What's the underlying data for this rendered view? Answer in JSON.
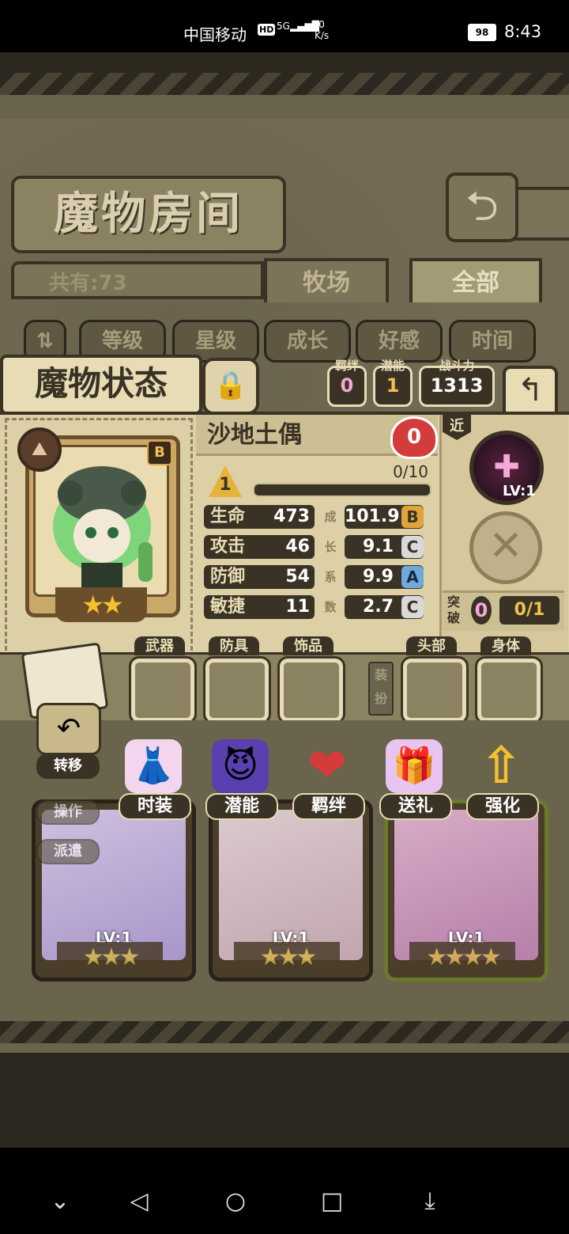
{
  "status_bar": {
    "carrier": "中国移动",
    "hd": "HD",
    "signal": "5G",
    "speed_value": "0",
    "speed_unit": "K/s",
    "battery": "98",
    "time": "8:43"
  },
  "header": {
    "title": "魔物房间",
    "back_icon": "return-arrow-icon",
    "count": "共有:73",
    "tabs": [
      "牧场",
      "全部"
    ],
    "active_tab": "全部"
  },
  "filters": [
    "等级",
    "星级",
    "成长",
    "好感",
    "时间"
  ],
  "status_panel": {
    "title": "魔物状态",
    "chips": [
      {
        "label": "羁绊",
        "value": "0",
        "color": "#f5a7d6"
      },
      {
        "label": "潜能",
        "value": "1",
        "color": "#f2c14e"
      },
      {
        "label": "战斗力",
        "value": "1313",
        "color": "#ffffff"
      }
    ],
    "monster": {
      "name": "沙地土偶",
      "grade": "B",
      "stars": "★★",
      "affection": "0",
      "level": "1",
      "exp": "0/10",
      "exp_fraction": 0.0
    },
    "stats": [
      {
        "label": "生命",
        "value": "473",
        "growth": "101.9",
        "grade": "B",
        "grade_color": "#e0a43a"
      },
      {
        "label": "攻击",
        "value": "46",
        "growth": "9.1",
        "grade": "C",
        "grade_color": "#d9d9d9"
      },
      {
        "label": "防御",
        "value": "54",
        "growth": "9.9",
        "grade": "A",
        "grade_color": "#6fa8dc"
      },
      {
        "label": "敏捷",
        "value": "11",
        "growth": "2.7",
        "grade": "C",
        "grade_color": "#d9d9d9"
      }
    ],
    "growth_label": [
      "成",
      "长",
      "系",
      "数"
    ],
    "range": "近",
    "skill_lv": "LV:1",
    "breakthrough": {
      "label": "突破",
      "gems": "0",
      "progress": "0/1"
    }
  },
  "equipment": {
    "slots": [
      "武器",
      "防具",
      "饰品",
      "头部",
      "身体"
    ],
    "dress_label": "装扮"
  },
  "actions": [
    {
      "label": "时装",
      "icon": "dress-icon",
      "glyph": "👗"
    },
    {
      "label": "潜能",
      "icon": "demon-icon",
      "glyph": "😈"
    },
    {
      "label": "羁绊",
      "icon": "hearts-icon",
      "glyph": "❤"
    },
    {
      "label": "送礼",
      "icon": "gift-icon",
      "glyph": "🎁"
    },
    {
      "label": "强化",
      "icon": "upgrade-arrows-icon",
      "glyph": "⇧"
    }
  ],
  "side_actions": [
    "转移",
    "操作",
    "派遣"
  ],
  "monster_list": [
    {
      "lv": "LV:1",
      "stars": "★★★",
      "color": "#b9a6e6"
    },
    {
      "lv": "LV:1",
      "stars": "★★★",
      "color": "#d7b8c8"
    },
    {
      "lv": "LV:1",
      "stars": "★★★★",
      "color": "#c98bc0"
    }
  ],
  "nav": [
    "chevron-down-icon",
    "back-triangle-icon",
    "home-circle-icon",
    "recents-square-icon",
    "download-icon"
  ]
}
